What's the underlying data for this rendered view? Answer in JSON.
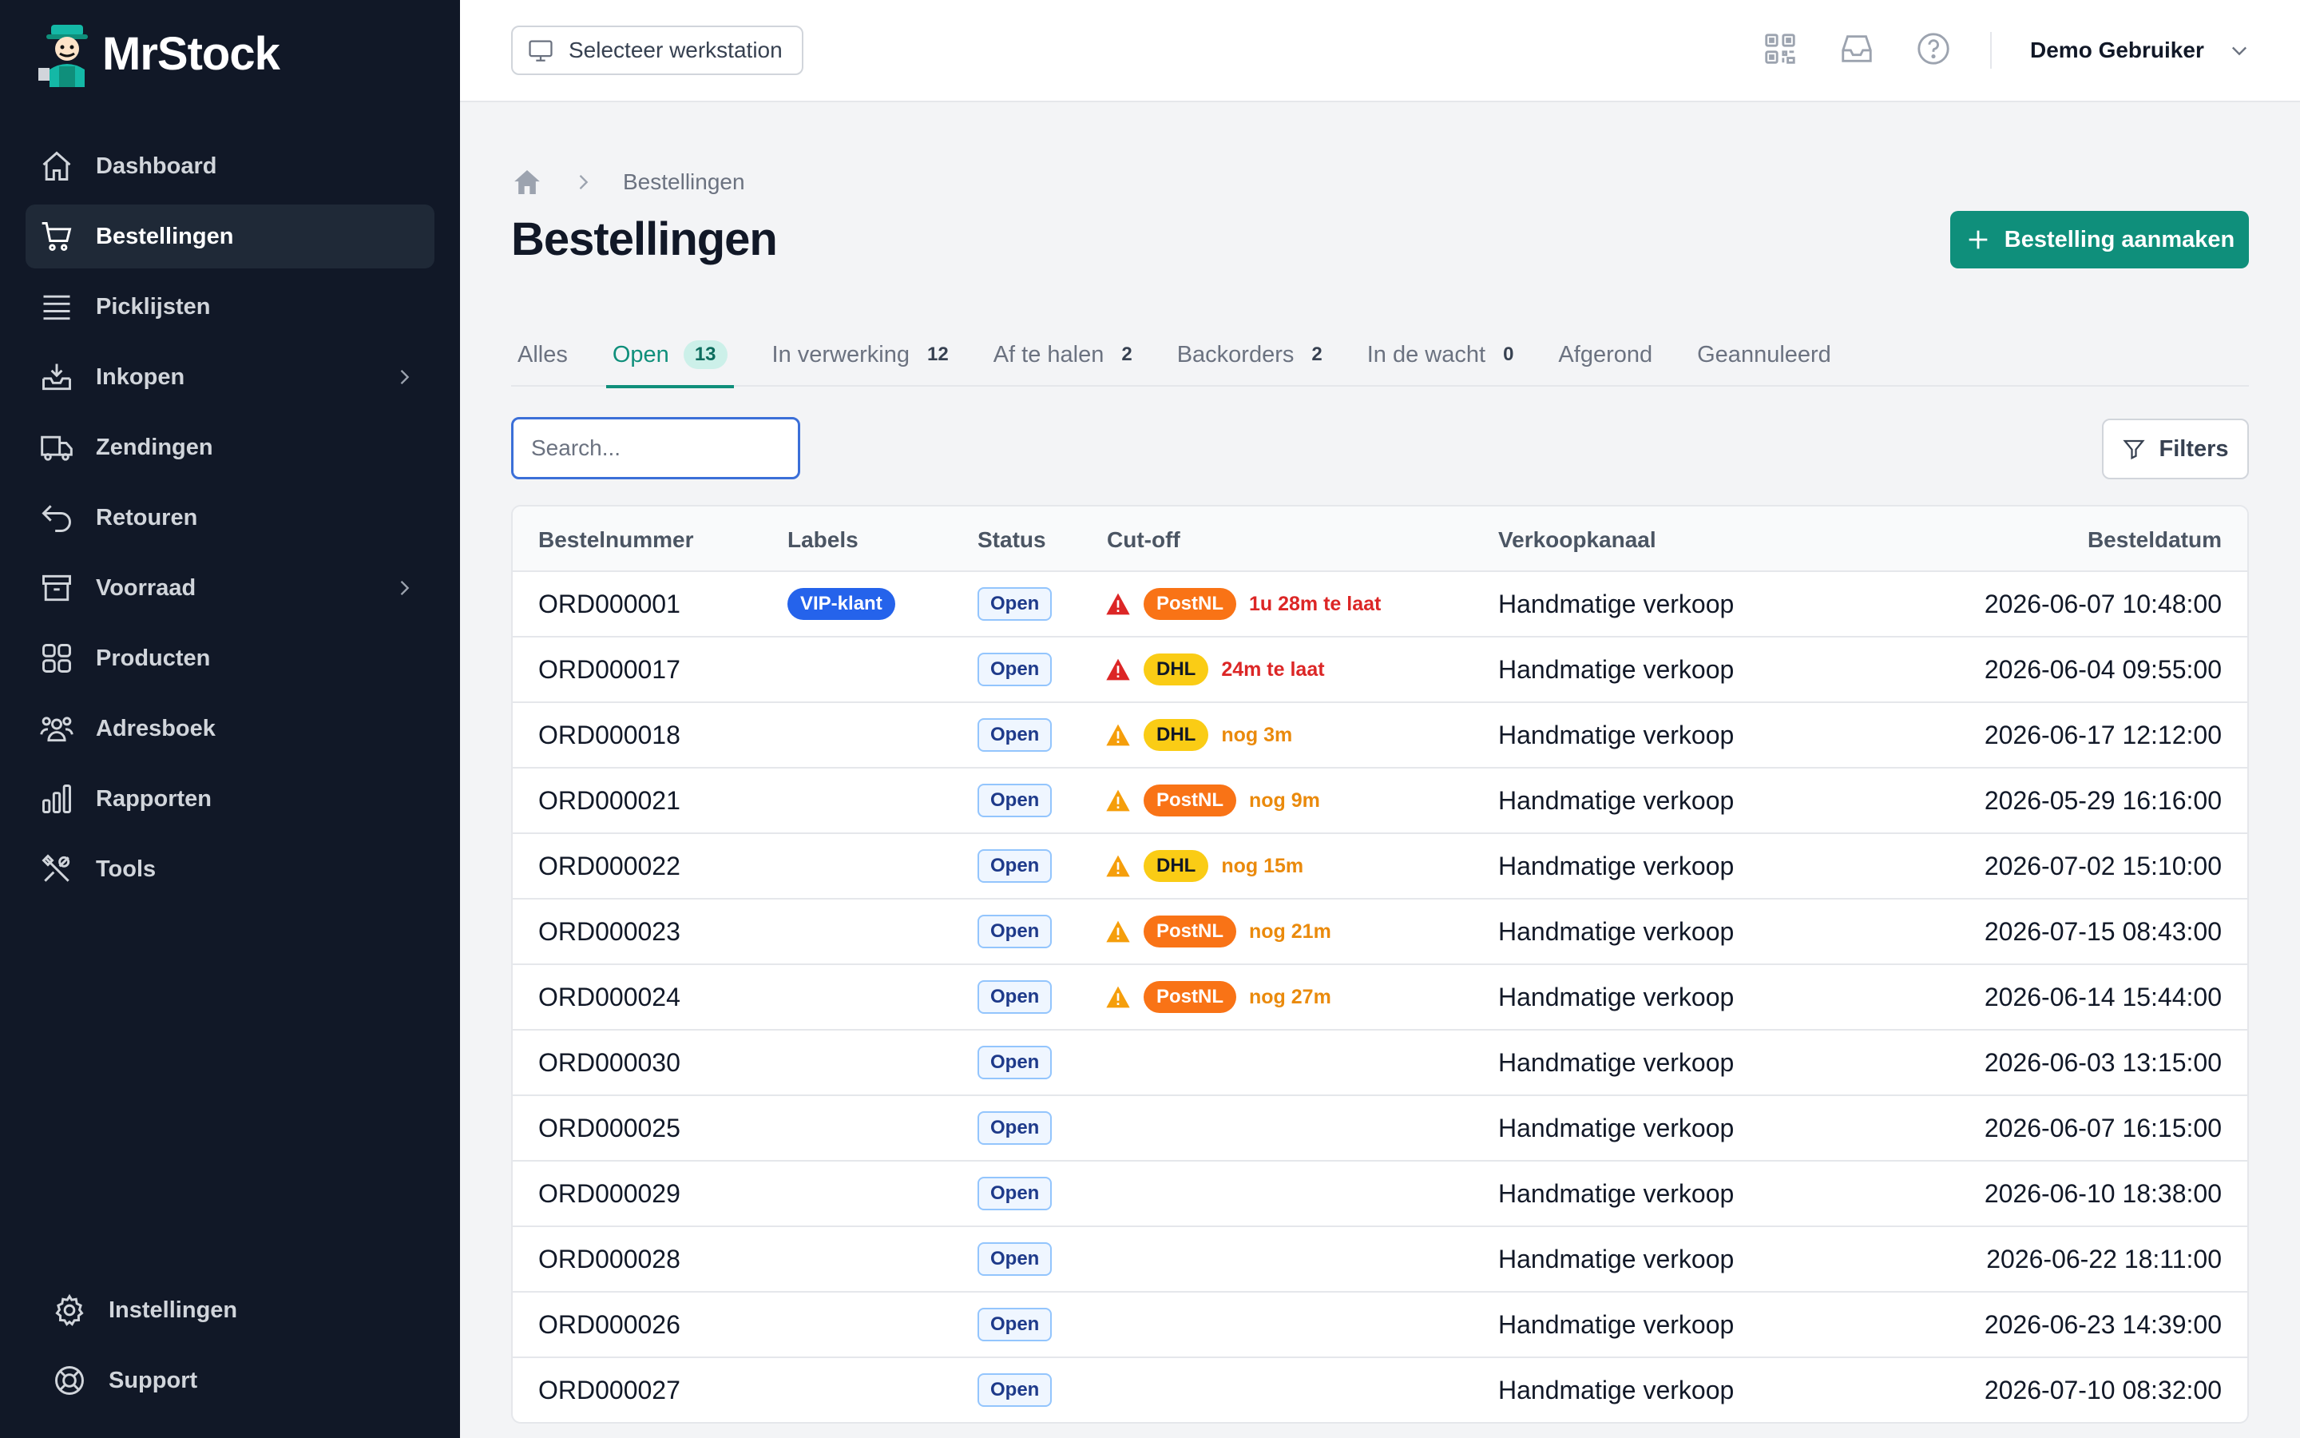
{
  "app": {
    "name": "MrStock"
  },
  "sidebar": {
    "items": [
      {
        "label": "Dashboard",
        "icon": "home-icon"
      },
      {
        "label": "Bestellingen",
        "icon": "cart-icon",
        "active": true
      },
      {
        "label": "Picklijsten",
        "icon": "list-icon"
      },
      {
        "label": "Inkopen",
        "icon": "inbox-download-icon",
        "chevron": true
      },
      {
        "label": "Zendingen",
        "icon": "truck-icon"
      },
      {
        "label": "Retouren",
        "icon": "return-arrow-icon"
      },
      {
        "label": "Voorraad",
        "icon": "archive-box-icon",
        "chevron": true
      },
      {
        "label": "Producten",
        "icon": "grid-icon"
      },
      {
        "label": "Adresboek",
        "icon": "users-icon"
      },
      {
        "label": "Rapporten",
        "icon": "bar-chart-icon"
      },
      {
        "label": "Tools",
        "icon": "tools-icon"
      }
    ],
    "bottom": [
      {
        "label": "Instellingen",
        "icon": "gear-icon"
      },
      {
        "label": "Support",
        "icon": "lifebuoy-icon"
      }
    ]
  },
  "topbar": {
    "workstation_label": "Selecteer werkstation",
    "user_name": "Demo Gebruiker"
  },
  "breadcrumb": {
    "current": "Bestellingen"
  },
  "page": {
    "title": "Bestellingen",
    "create_label": "Bestelling aanmaken",
    "search_placeholder": "Search...",
    "filters_label": "Filters"
  },
  "tabs": [
    {
      "label": "Alles",
      "count": ""
    },
    {
      "label": "Open",
      "count": "13",
      "active": true
    },
    {
      "label": "In verwerking",
      "count": "12"
    },
    {
      "label": "Af te halen",
      "count": "2"
    },
    {
      "label": "Backorders",
      "count": "2"
    },
    {
      "label": "In de wacht",
      "count": "0"
    },
    {
      "label": "Afgerond",
      "count": ""
    },
    {
      "label": "Geannuleerd",
      "count": ""
    }
  ],
  "table": {
    "columns": [
      "Bestelnummer",
      "Labels",
      "Status",
      "Cut-off",
      "Verkoopkanaal",
      "Besteldatum"
    ],
    "rows": [
      {
        "num": "ORD000001",
        "label": "VIP-klant",
        "status": "Open",
        "carrier": "PostNL",
        "cutoff": "1u 28m te laat",
        "severity": "late",
        "channel": "Handmatige verkoop",
        "date": "2026-06-07 10:48:00"
      },
      {
        "num": "ORD000017",
        "label": "",
        "status": "Open",
        "carrier": "DHL",
        "cutoff": "24m te laat",
        "severity": "late",
        "channel": "Handmatige verkoop",
        "date": "2026-06-04 09:55:00"
      },
      {
        "num": "ORD000018",
        "label": "",
        "status": "Open",
        "carrier": "DHL",
        "cutoff": "nog 3m",
        "severity": "soon",
        "channel": "Handmatige verkoop",
        "date": "2026-06-17 12:12:00"
      },
      {
        "num": "ORD000021",
        "label": "",
        "status": "Open",
        "carrier": "PostNL",
        "cutoff": "nog 9m",
        "severity": "soon",
        "channel": "Handmatige verkoop",
        "date": "2026-05-29 16:16:00"
      },
      {
        "num": "ORD000022",
        "label": "",
        "status": "Open",
        "carrier": "DHL",
        "cutoff": "nog 15m",
        "severity": "soon",
        "channel": "Handmatige verkoop",
        "date": "2026-07-02 15:10:00"
      },
      {
        "num": "ORD000023",
        "label": "",
        "status": "Open",
        "carrier": "PostNL",
        "cutoff": "nog 21m",
        "severity": "soon",
        "channel": "Handmatige verkoop",
        "date": "2026-07-15 08:43:00"
      },
      {
        "num": "ORD000024",
        "label": "",
        "status": "Open",
        "carrier": "PostNL",
        "cutoff": "nog 27m",
        "severity": "soon",
        "channel": "Handmatige verkoop",
        "date": "2026-06-14 15:44:00"
      },
      {
        "num": "ORD000030",
        "label": "",
        "status": "Open",
        "carrier": "",
        "cutoff": "",
        "severity": "",
        "channel": "Handmatige verkoop",
        "date": "2026-06-03 13:15:00"
      },
      {
        "num": "ORD000025",
        "label": "",
        "status": "Open",
        "carrier": "",
        "cutoff": "",
        "severity": "",
        "channel": "Handmatige verkoop",
        "date": "2026-06-07 16:15:00"
      },
      {
        "num": "ORD000029",
        "label": "",
        "status": "Open",
        "carrier": "",
        "cutoff": "",
        "severity": "",
        "channel": "Handmatige verkoop",
        "date": "2026-06-10 18:38:00"
      },
      {
        "num": "ORD000028",
        "label": "",
        "status": "Open",
        "carrier": "",
        "cutoff": "",
        "severity": "",
        "channel": "Handmatige verkoop",
        "date": "2026-06-22 18:11:00"
      },
      {
        "num": "ORD000026",
        "label": "",
        "status": "Open",
        "carrier": "",
        "cutoff": "",
        "severity": "",
        "channel": "Handmatige verkoop",
        "date": "2026-06-23 14:39:00"
      },
      {
        "num": "ORD000027",
        "label": "",
        "status": "Open",
        "carrier": "",
        "cutoff": "",
        "severity": "",
        "channel": "Handmatige verkoop",
        "date": "2026-07-10 08:32:00"
      }
    ]
  },
  "colors": {
    "sidebar_bg": "#111827",
    "accent": "#0f8f7b",
    "vip": "#2563eb",
    "postnl": "#f97316",
    "dhl": "#facc15",
    "late": "#dc2626",
    "soon": "#ea8a0c"
  }
}
